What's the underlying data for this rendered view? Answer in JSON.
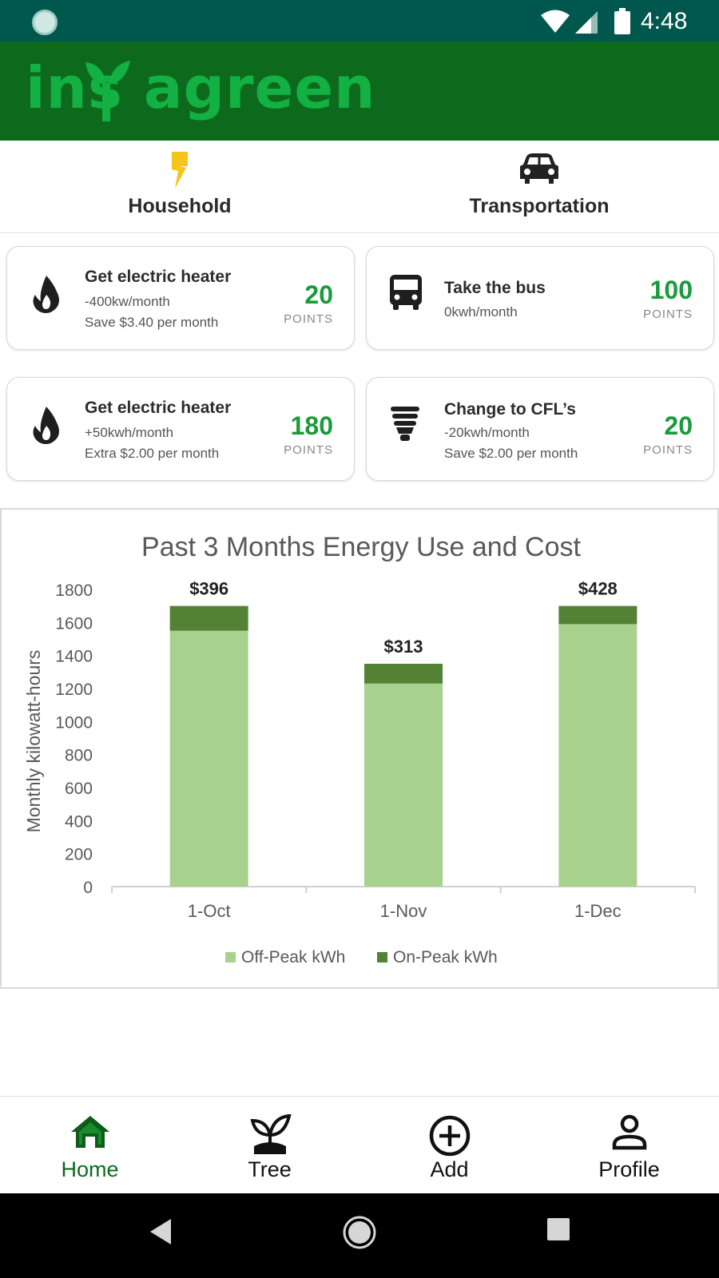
{
  "status_bar": {
    "time": "4:48"
  },
  "header": {
    "app_name": "insTagreen"
  },
  "tabs": [
    {
      "label": "Household",
      "icon": "lightning-icon",
      "color": "#f5c518"
    },
    {
      "label": "Transportation",
      "icon": "car-icon"
    }
  ],
  "cards": [
    {
      "title": "Get electric heater",
      "line1": "-400kw/month",
      "line2": "Save $3.40 per month",
      "points": "20",
      "points_label": "POINTS",
      "icon": "flame-icon"
    },
    {
      "title": "Take the bus",
      "line1": "0kwh/month",
      "line2": "",
      "points": "100",
      "points_label": "POINTS",
      "icon": "bus-icon"
    },
    {
      "title": "Get electric heater",
      "line1": "+50kwh/month",
      "line2": "Extra $2.00 per month",
      "points": "180",
      "points_label": "POINTS",
      "icon": "flame-icon"
    },
    {
      "title": "Change to CFL’s",
      "line1": "-20kwh/month",
      "line2": "Save $2.00 per month",
      "points": "20",
      "points_label": "POINTS",
      "icon": "cfl-bulb-icon"
    }
  ],
  "chart_data": {
    "type": "bar",
    "stacked": true,
    "title": "Past 3 Months Energy Use and Cost",
    "ylabel": "Monthly kilowatt-hours",
    "xlabel": "",
    "categories": [
      "1-Oct",
      "1-Nov",
      "1-Dec"
    ],
    "ylim": [
      0,
      1800
    ],
    "yticks": [
      "0",
      "200",
      "400",
      "600",
      "800",
      "1000",
      "1200",
      "1400",
      "1600",
      "1800"
    ],
    "series": [
      {
        "name": "Off-Peak kWh",
        "values": [
          1550,
          1230,
          1590
        ],
        "color": "#a8d18d"
      },
      {
        "name": "On-Peak kWh",
        "values": [
          150,
          120,
          110
        ],
        "color": "#548235"
      }
    ],
    "data_labels": [
      "$396",
      "$313",
      "$428"
    ],
    "legend": "bottom",
    "grid": false
  },
  "bottom_nav": [
    {
      "label": "Home",
      "icon": "home-icon",
      "active": true
    },
    {
      "label": "Tree",
      "icon": "sprout-icon",
      "active": false
    },
    {
      "label": "Add",
      "icon": "add-circle-icon",
      "active": false
    },
    {
      "label": "Profile",
      "icon": "person-icon",
      "active": false
    }
  ],
  "colors": {
    "status_bar": "#00574d",
    "header": "#0d6a1d",
    "logo": "#13b043",
    "points": "#1a9b3a",
    "active_nav": "#0d6a1d"
  }
}
